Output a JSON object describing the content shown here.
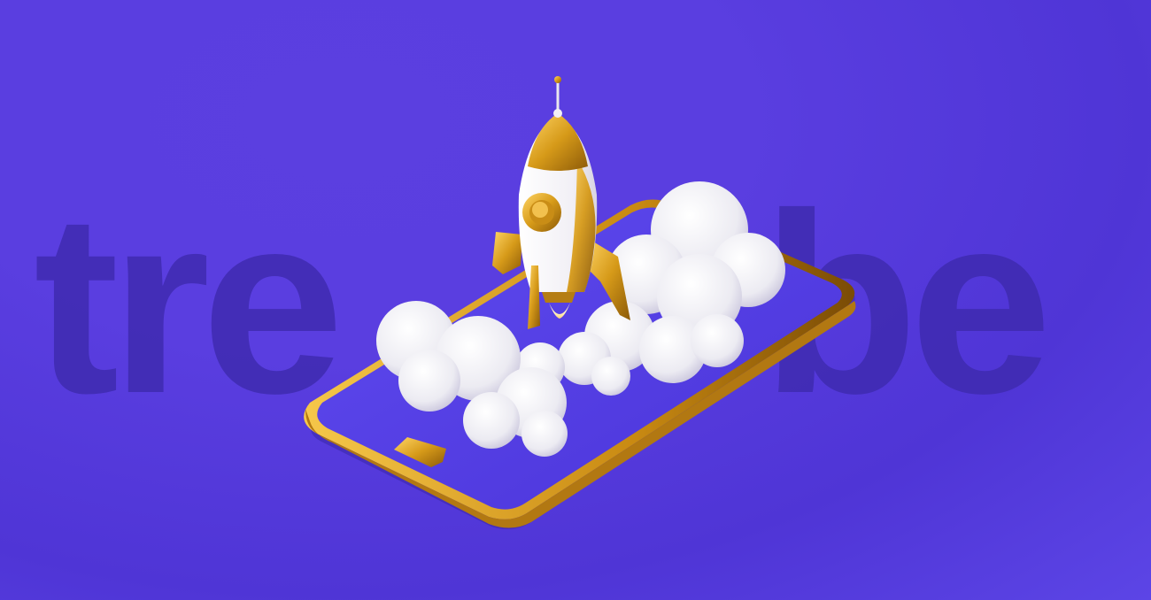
{
  "brand": {
    "word_left": "tre",
    "word_right": "be"
  },
  "colors": {
    "background": "#5a3ee0",
    "wordmark": "#3f2bb0",
    "gold": "#d9a21f",
    "phone_screen": "#5b45ea",
    "cloud": "#f3f1f6"
  },
  "illustration": {
    "subject": "rocket-launch-from-phone",
    "elements": [
      "rocket-icon",
      "cloud-icon",
      "phone-icon"
    ]
  }
}
